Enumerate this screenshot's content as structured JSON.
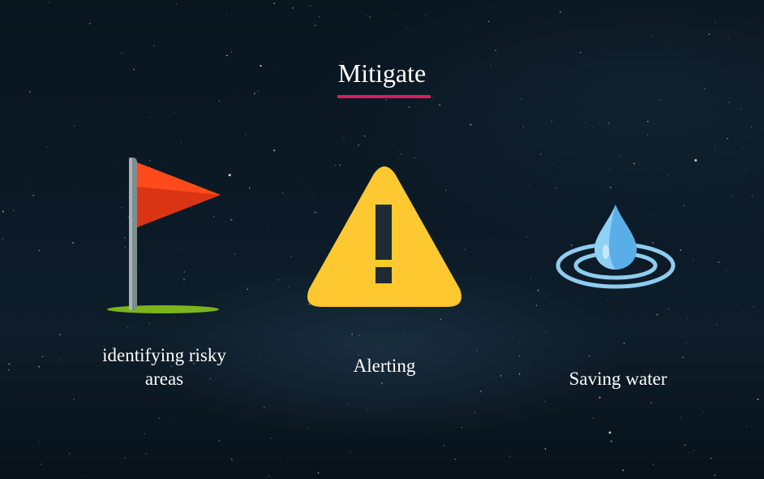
{
  "slide": {
    "title": "Mitigate",
    "accent_color": "#d81b60",
    "items": [
      {
        "icon": "flag-icon",
        "label": "identifying risky areas"
      },
      {
        "icon": "warning-icon",
        "label": "Alerting"
      },
      {
        "icon": "water-drop-icon",
        "label": "Saving water"
      }
    ]
  }
}
